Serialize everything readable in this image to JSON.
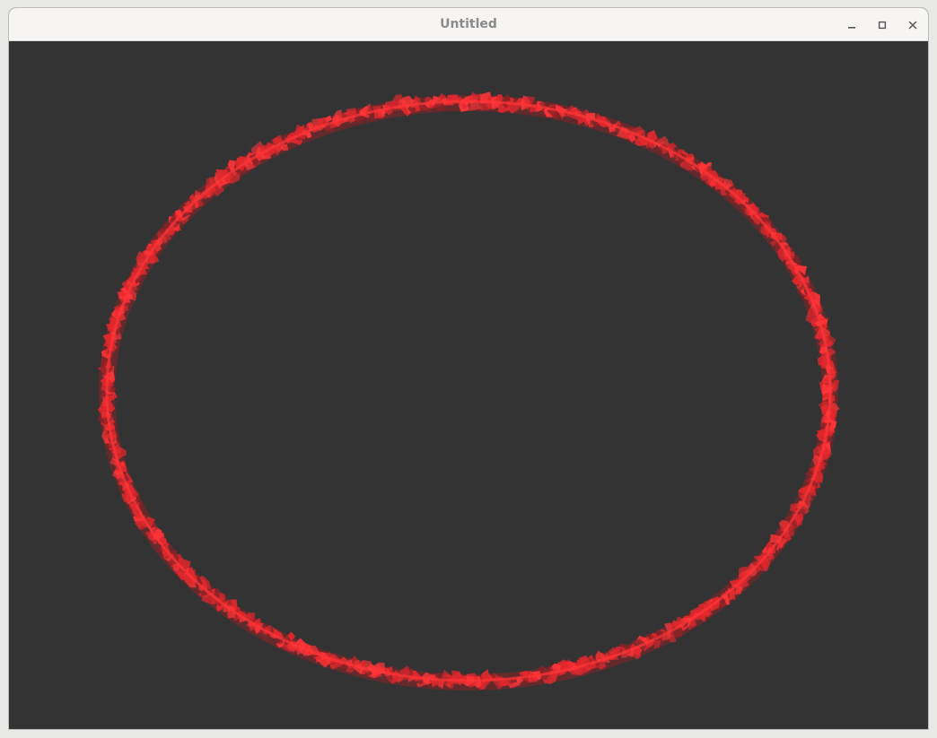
{
  "window": {
    "title": "Untitled",
    "controls": {
      "minimize": "minimize-icon",
      "maximize": "maximize-icon",
      "close": "close-icon"
    }
  },
  "canvas": {
    "background": "#333333",
    "shape": "ellipse",
    "stroke_color": "#e0282d",
    "highlight_color": "#ff3538",
    "shadow_color": "#8a2326"
  }
}
